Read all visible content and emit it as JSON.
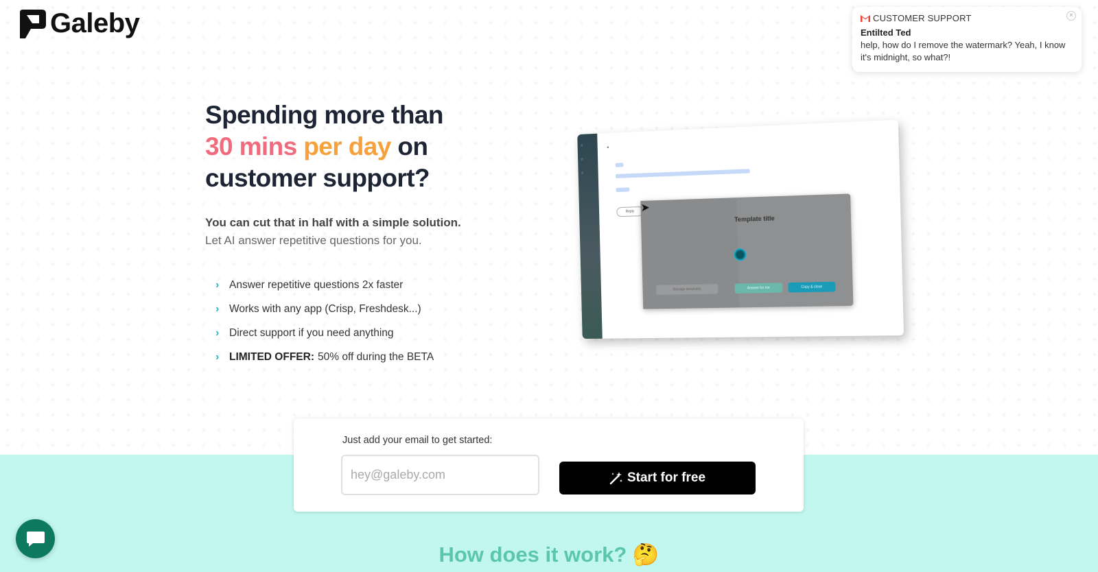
{
  "brand": {
    "name": "Galeby"
  },
  "notification": {
    "app_icon": "gmail-icon",
    "source": "CUSTOMER SUPPORT",
    "sender": "Entilted Ted",
    "message": "help, how do I remove the watermark? Yeah, I know it's midnight, so what?!"
  },
  "hero": {
    "title_prefix": "Spending more than",
    "title_highlight_1": "30 mins",
    "title_highlight_2": "per day",
    "title_suffix": "on customer support?",
    "sub_bold": "You can cut that in half with a simple solution.",
    "sub_light": "Let AI answer repetitive questions for you."
  },
  "features": [
    {
      "bold": "",
      "text": "Answer repetitive questions 2x faster"
    },
    {
      "bold": "",
      "text": "Works with any app (Crisp, Freshdesk...)"
    },
    {
      "bold": "",
      "text": "Direct support if you need anything"
    },
    {
      "bold": "LIMITED OFFER:",
      "text": "50% off during the BETA"
    }
  ],
  "mockup": {
    "modal_title": "Template title",
    "reply_label": "Reply",
    "btn_1": "Manage templates",
    "btn_2": "Answer for me",
    "btn_3": "Copy & close"
  },
  "cta": {
    "label": "Just add your email to get started:",
    "placeholder": "hey@galeby.com",
    "button": "Start for free",
    "button_icon": "magic-wand-icon"
  },
  "section": {
    "heading": "How does it work? 🤔"
  },
  "colors": {
    "accent_pink": "#f06b7e",
    "accent_orange": "#f6a13c",
    "teal_band": "#c2f7f0",
    "heading_teal": "#5cc6ad",
    "chat": "#0d7a5f"
  }
}
